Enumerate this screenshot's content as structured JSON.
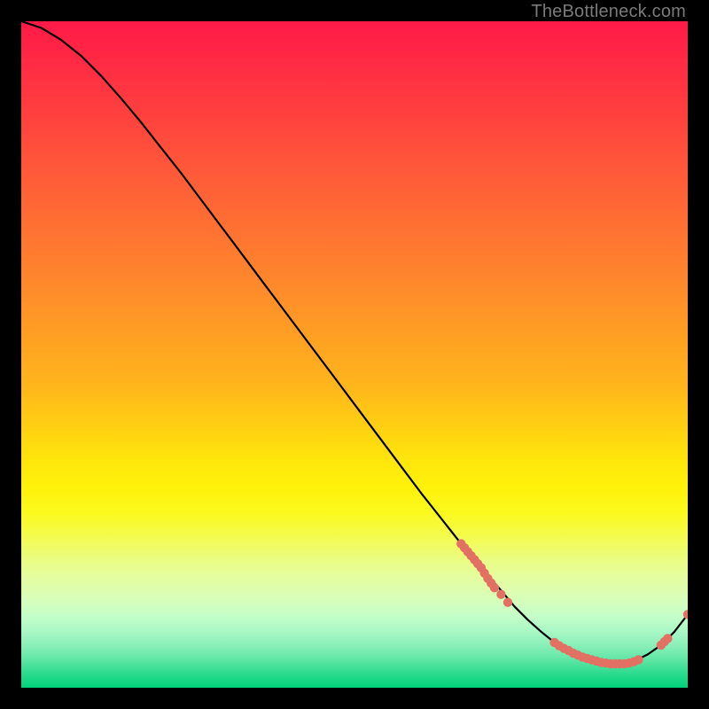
{
  "watermark": "TheBottleneck.com",
  "colors": {
    "frame": "#000000",
    "curve": "#000000",
    "marker": "#e27063",
    "watermark": "#7a7a7a"
  },
  "chart_data": {
    "type": "line",
    "title": "",
    "xlabel": "",
    "ylabel": "",
    "xlim": [
      0,
      100
    ],
    "ylim": [
      0,
      100
    ],
    "grid": false,
    "legend": false,
    "series": [
      {
        "name": "bottleneck-curve",
        "x": [
          0,
          3,
          6,
          9,
          12,
          15,
          18,
          21,
          24,
          27,
          30,
          33,
          36,
          39,
          42,
          45,
          48,
          51,
          54,
          57,
          60,
          63,
          66,
          69,
          72,
          74,
          76,
          78,
          80,
          82,
          84,
          86,
          88,
          90,
          92,
          94,
          96,
          98,
          100
        ],
        "y": [
          100,
          99,
          97.2,
          94.8,
          91.8,
          88.4,
          84.8,
          81,
          77.2,
          73.2,
          69.2,
          65.2,
          61.2,
          57.2,
          53.2,
          49.2,
          45.2,
          41.2,
          37.2,
          33.2,
          29.2,
          25.4,
          21.6,
          18,
          14.6,
          12.2,
          10.2,
          8.4,
          6.8,
          5.6,
          4.6,
          4,
          3.6,
          3.6,
          4,
          5,
          6.4,
          8.4,
          11
        ]
      }
    ],
    "markers": [
      {
        "x": 66,
        "y": 21.6
      },
      {
        "x": 66.5,
        "y": 21.0
      },
      {
        "x": 67,
        "y": 20.4
      },
      {
        "x": 67.5,
        "y": 19.8
      },
      {
        "x": 68,
        "y": 19.2
      },
      {
        "x": 68.5,
        "y": 18.6
      },
      {
        "x": 69,
        "y": 18.0
      },
      {
        "x": 69.5,
        "y": 17.2
      },
      {
        "x": 70,
        "y": 16.4
      },
      {
        "x": 70.5,
        "y": 15.7
      },
      {
        "x": 71,
        "y": 15.0
      },
      {
        "x": 72,
        "y": 14.0
      },
      {
        "x": 73,
        "y": 12.8
      },
      {
        "x": 80,
        "y": 6.8
      },
      {
        "x": 80.7,
        "y": 6.3
      },
      {
        "x": 81.4,
        "y": 5.9
      },
      {
        "x": 82.1,
        "y": 5.6
      },
      {
        "x": 82.8,
        "y": 5.2
      },
      {
        "x": 83.5,
        "y": 4.9
      },
      {
        "x": 84.2,
        "y": 4.6
      },
      {
        "x": 84.9,
        "y": 4.4
      },
      {
        "x": 85.6,
        "y": 4.2
      },
      {
        "x": 86.3,
        "y": 4.0
      },
      {
        "x": 87,
        "y": 3.8
      },
      {
        "x": 87.7,
        "y": 3.7
      },
      {
        "x": 88.4,
        "y": 3.6
      },
      {
        "x": 89.1,
        "y": 3.6
      },
      {
        "x": 89.8,
        "y": 3.6
      },
      {
        "x": 90.5,
        "y": 3.6
      },
      {
        "x": 91.2,
        "y": 3.7
      },
      {
        "x": 91.9,
        "y": 3.9
      },
      {
        "x": 92.6,
        "y": 4.2
      },
      {
        "x": 96,
        "y": 6.4
      },
      {
        "x": 96.5,
        "y": 6.9
      },
      {
        "x": 97,
        "y": 7.4
      },
      {
        "x": 100,
        "y": 11.0
      }
    ]
  }
}
